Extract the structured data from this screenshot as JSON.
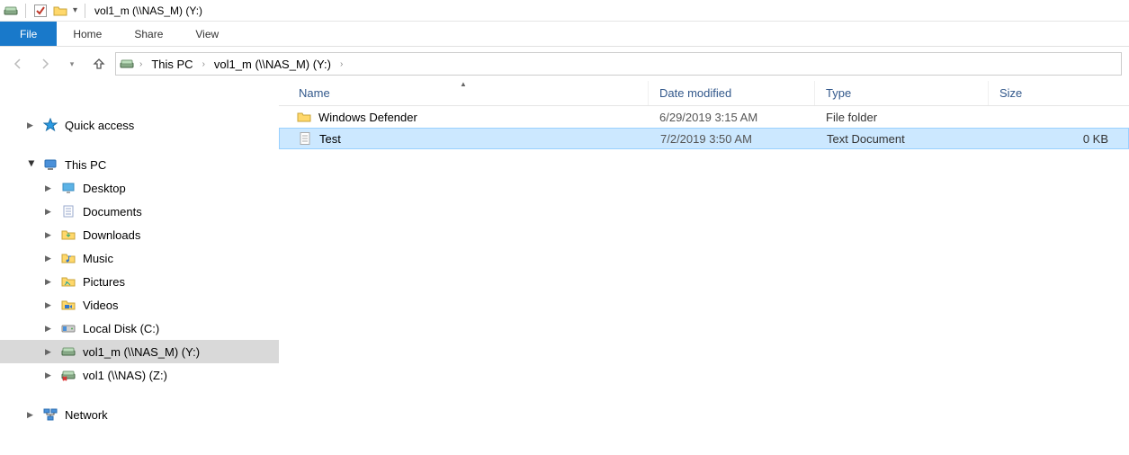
{
  "window": {
    "title": "vol1_m (\\\\NAS_M) (Y:)"
  },
  "ribbon": {
    "file": "File",
    "tabs": [
      "Home",
      "Share",
      "View"
    ]
  },
  "breadcrumb": {
    "items": [
      "This PC",
      "vol1_m (\\\\NAS_M) (Y:)"
    ]
  },
  "nav": {
    "quick_access": "Quick access",
    "this_pc": "This PC",
    "children": [
      {
        "label": "Desktop",
        "icon": "desktop"
      },
      {
        "label": "Documents",
        "icon": "documents"
      },
      {
        "label": "Downloads",
        "icon": "downloads"
      },
      {
        "label": "Music",
        "icon": "music"
      },
      {
        "label": "Pictures",
        "icon": "pictures"
      },
      {
        "label": "Videos",
        "icon": "videos"
      },
      {
        "label": "Local Disk (C:)",
        "icon": "disk"
      },
      {
        "label": "vol1_m (\\\\NAS_M) (Y:)",
        "icon": "netdrive",
        "selected": true
      },
      {
        "label": "vol1 (\\\\NAS) (Z:)",
        "icon": "netdrive-x"
      }
    ],
    "network": "Network"
  },
  "columns": {
    "name": "Name",
    "date": "Date modified",
    "type": "Type",
    "size": "Size"
  },
  "rows": [
    {
      "name": "Windows Defender",
      "date": "6/29/2019 3:15 AM",
      "type": "File folder",
      "size": "",
      "icon": "folder",
      "selected": false
    },
    {
      "name": "Test",
      "date": "7/2/2019 3:50 AM",
      "type": "Text Document",
      "size": "0 KB",
      "icon": "textfile",
      "selected": true
    }
  ]
}
